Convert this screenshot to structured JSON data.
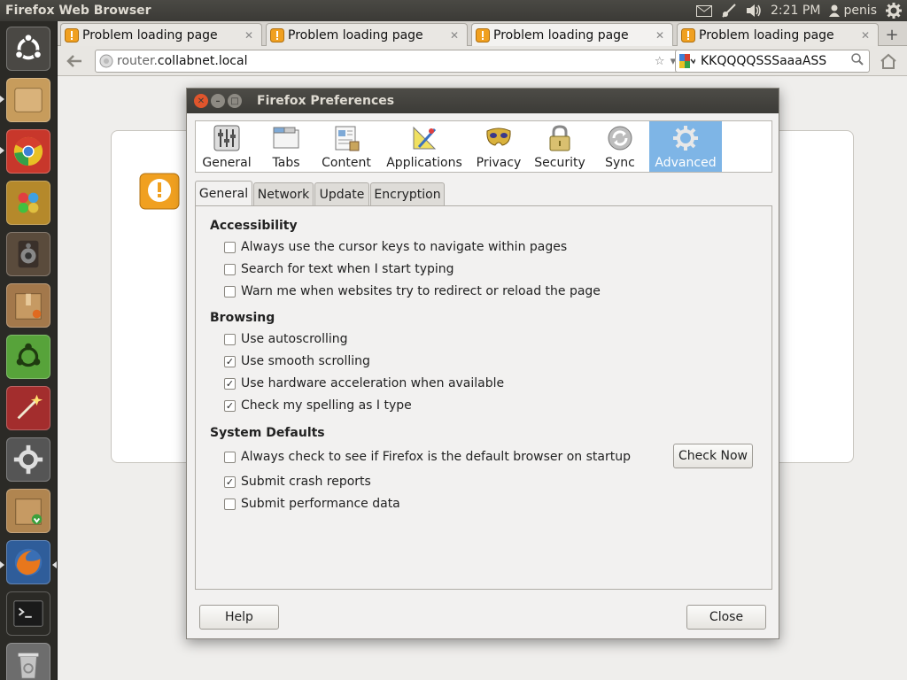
{
  "panel": {
    "app_title": "Firefox Web Browser",
    "clock": "2:21 PM",
    "user": "penis"
  },
  "tabs": [
    {
      "label": "Problem loading page"
    },
    {
      "label": "Problem loading page"
    },
    {
      "label": "Problem loading page"
    },
    {
      "label": "Problem loading page"
    }
  ],
  "navbar": {
    "url_host_prefix": "router.",
    "url_host_main": "collabnet.local",
    "search_value": "KKQQQQSSSaaaASS"
  },
  "dialog": {
    "title": "Firefox Preferences",
    "panes": [
      "General",
      "Tabs",
      "Content",
      "Applications",
      "Privacy",
      "Security",
      "Sync",
      "Advanced"
    ],
    "selected_pane": "Advanced",
    "subtabs": [
      "General",
      "Network",
      "Update",
      "Encryption"
    ],
    "active_subtab": "General",
    "sections": {
      "accessibility": "Accessibility",
      "browsing": "Browsing",
      "system_defaults": "System Defaults"
    },
    "options": {
      "cursor_keys": {
        "label": "Always use the cursor keys to navigate within pages",
        "checked": false
      },
      "search_typing": {
        "label": "Search for text when I start typing",
        "checked": false
      },
      "warn_redirect": {
        "label": "Warn me when websites try to redirect or reload the page",
        "checked": false
      },
      "autoscrolling": {
        "label": "Use autoscrolling",
        "checked": false
      },
      "smooth_scrolling": {
        "label": "Use smooth scrolling",
        "checked": true
      },
      "hw_accel": {
        "label": "Use hardware acceleration when available",
        "checked": true
      },
      "spelling": {
        "label": "Check my spelling as I type",
        "checked": true
      },
      "default_browser": {
        "label": "Always check to see if Firefox is the default browser on startup",
        "checked": false
      },
      "crash_reports": {
        "label": "Submit crash reports",
        "checked": true
      },
      "perf_data": {
        "label": "Submit performance data",
        "checked": false
      }
    },
    "buttons": {
      "check_now": "Check Now",
      "help": "Help",
      "close": "Close"
    }
  },
  "colors": {
    "selected_pane": "#7eb5e6",
    "launcher_bg": "#2b2a26",
    "panel_bg": "#3c3b37"
  }
}
